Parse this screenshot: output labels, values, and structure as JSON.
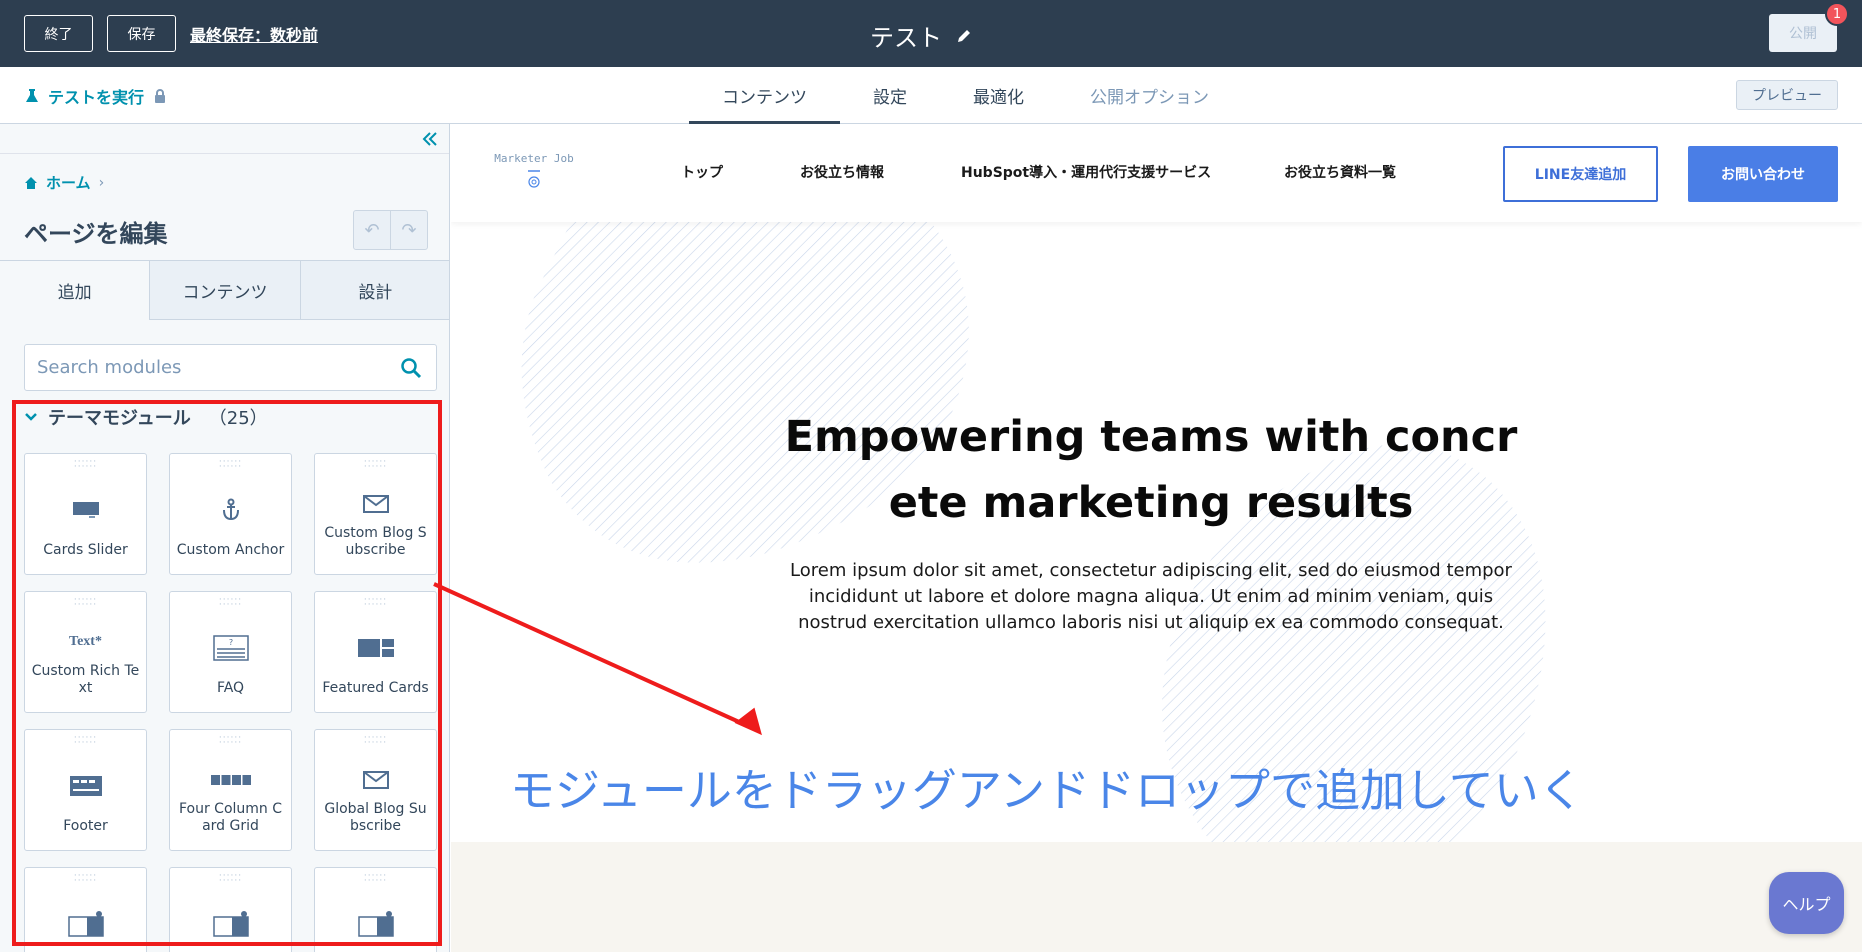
{
  "topbar": {
    "exit_label": "終了",
    "save_label": "保存",
    "last_saved": "最終保存：数秒前",
    "page_title": "テスト",
    "publish_label": "公開",
    "notification_count": "1"
  },
  "subbar": {
    "run_test_label": "テストを実行",
    "tabs": [
      {
        "label": "コンテンツ",
        "active": true
      },
      {
        "label": "設定",
        "active": false
      },
      {
        "label": "最適化",
        "active": false
      },
      {
        "label": "公開オプション",
        "active": false
      }
    ],
    "preview_label": "プレビュー"
  },
  "left_panel": {
    "breadcrumb_home": "ホーム",
    "title": "ページを編集",
    "tabs": [
      {
        "label": "追加",
        "active": true
      },
      {
        "label": "コンテンツ",
        "active": false
      },
      {
        "label": "設計",
        "active": false
      }
    ],
    "search_placeholder": "Search modules",
    "section_title": "テーマモジュール",
    "section_count": "（25）",
    "modules": [
      {
        "label": "Cards Slider",
        "icon": "slider-icon"
      },
      {
        "label": "Custom Anchor",
        "icon": "anchor-icon"
      },
      {
        "label": "Custom Blog Subscribe",
        "icon": "envelope-icon"
      },
      {
        "label": "Custom Rich Text",
        "icon": "rich-text-icon"
      },
      {
        "label": "FAQ",
        "icon": "faq-icon"
      },
      {
        "label": "Featured Cards",
        "icon": "featured-cards-icon"
      },
      {
        "label": "Footer",
        "icon": "footer-icon"
      },
      {
        "label": "Four Column Card Grid",
        "icon": "four-column-icon"
      },
      {
        "label": "Global Blog Subscribe",
        "icon": "envelope-icon"
      },
      {
        "label": "",
        "icon": "image-text-icon"
      },
      {
        "label": "",
        "icon": "image-text-icon"
      },
      {
        "label": "",
        "icon": "image-text-icon"
      }
    ]
  },
  "preview": {
    "logo_text": "Marketer Job",
    "nav": [
      "トップ",
      "お役立ち情報",
      "HubSpot導入・運用代行支援サービス",
      "お役立ち資料一覧"
    ],
    "btn_line": "LINE友達追加",
    "btn_contact": "お問い合わせ",
    "hero_title_line1": "Empowering teams with concr",
    "hero_title_line2": "ete marketing results",
    "hero_body": "Lorem ipsum dolor sit amet, consectetur adipiscing elit, sed do eiusmod tempor incididunt ut labore et dolore magna aliqua. Ut enim ad minim veniam, quis nostrud exercitation ullamco laboris nisi ut aliquip ex ea commodo consequat.",
    "annotation": "モジュールをドラッグアンドドロップで追加していく"
  },
  "help_label": "ヘルプ",
  "colors": {
    "topbar": "#2d3e50",
    "link": "#0091ae",
    "annotation_red": "#ee1c1c",
    "annotation_blue": "#4a86e8",
    "cta_blue": "#4a7ee6"
  }
}
